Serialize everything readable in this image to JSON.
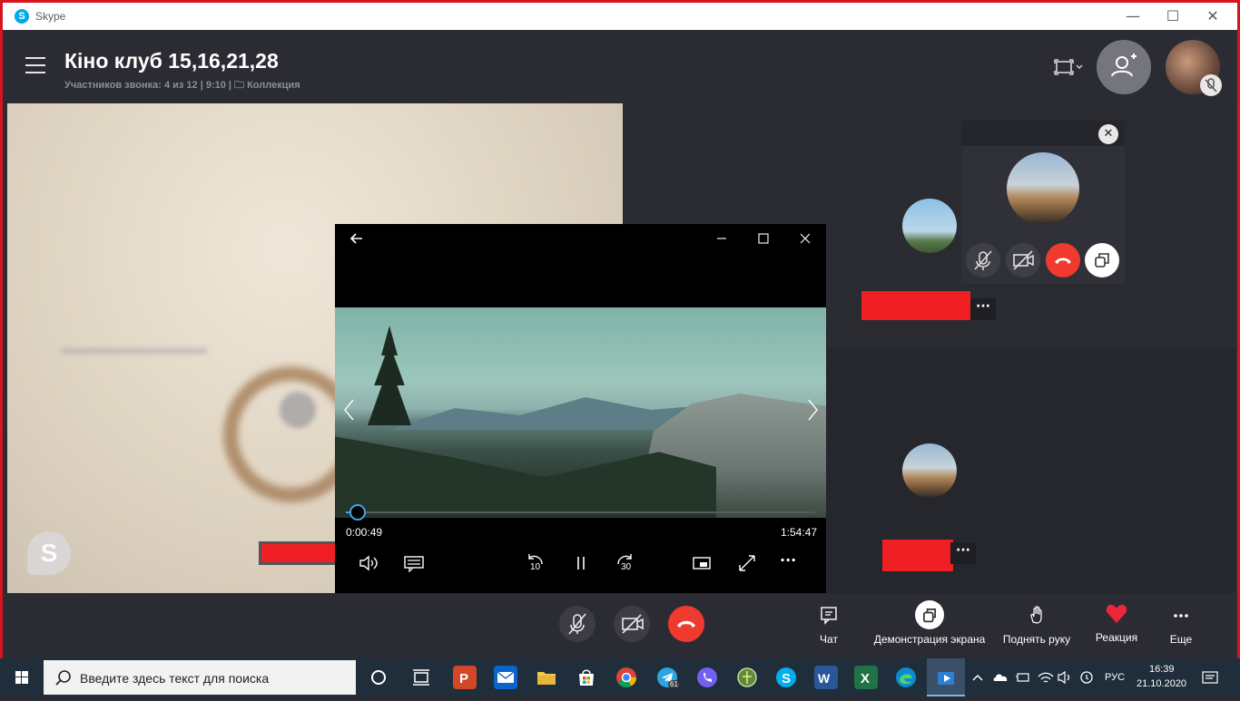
{
  "window": {
    "app_name": "Skype",
    "minimize": "—",
    "maximize": "☐",
    "close": "✕"
  },
  "call": {
    "title": "Кіно клуб 15,16,21,28",
    "subtitle": "Участников звонка: 4 из 12 | 9:10 | 🗀 Коллекция"
  },
  "participants": {
    "more_label": "···"
  },
  "mini_call": {
    "close": "✕"
  },
  "player": {
    "current_time": "0:00:49",
    "total_time": "1:54:47",
    "progress": 0.007,
    "skip_back_label": "10",
    "skip_forward_label": "30",
    "more_label": "···"
  },
  "call_controls": {
    "actions": [
      {
        "label": "Чат"
      },
      {
        "label": "Демонстрация экрана"
      },
      {
        "label": "Поднять руку"
      },
      {
        "label": "Реакция"
      },
      {
        "label": "Еще"
      }
    ]
  },
  "taskbar": {
    "search_placeholder": "Введите здесь текст для поиска",
    "telegram_badge": "61",
    "language": "РУС",
    "time": "16:39",
    "date": "21.10.2020"
  },
  "colors": {
    "accent_red": "#ef3a2f",
    "name_redaction": "#ef1f24",
    "seek_blue": "#4aa0e6"
  }
}
